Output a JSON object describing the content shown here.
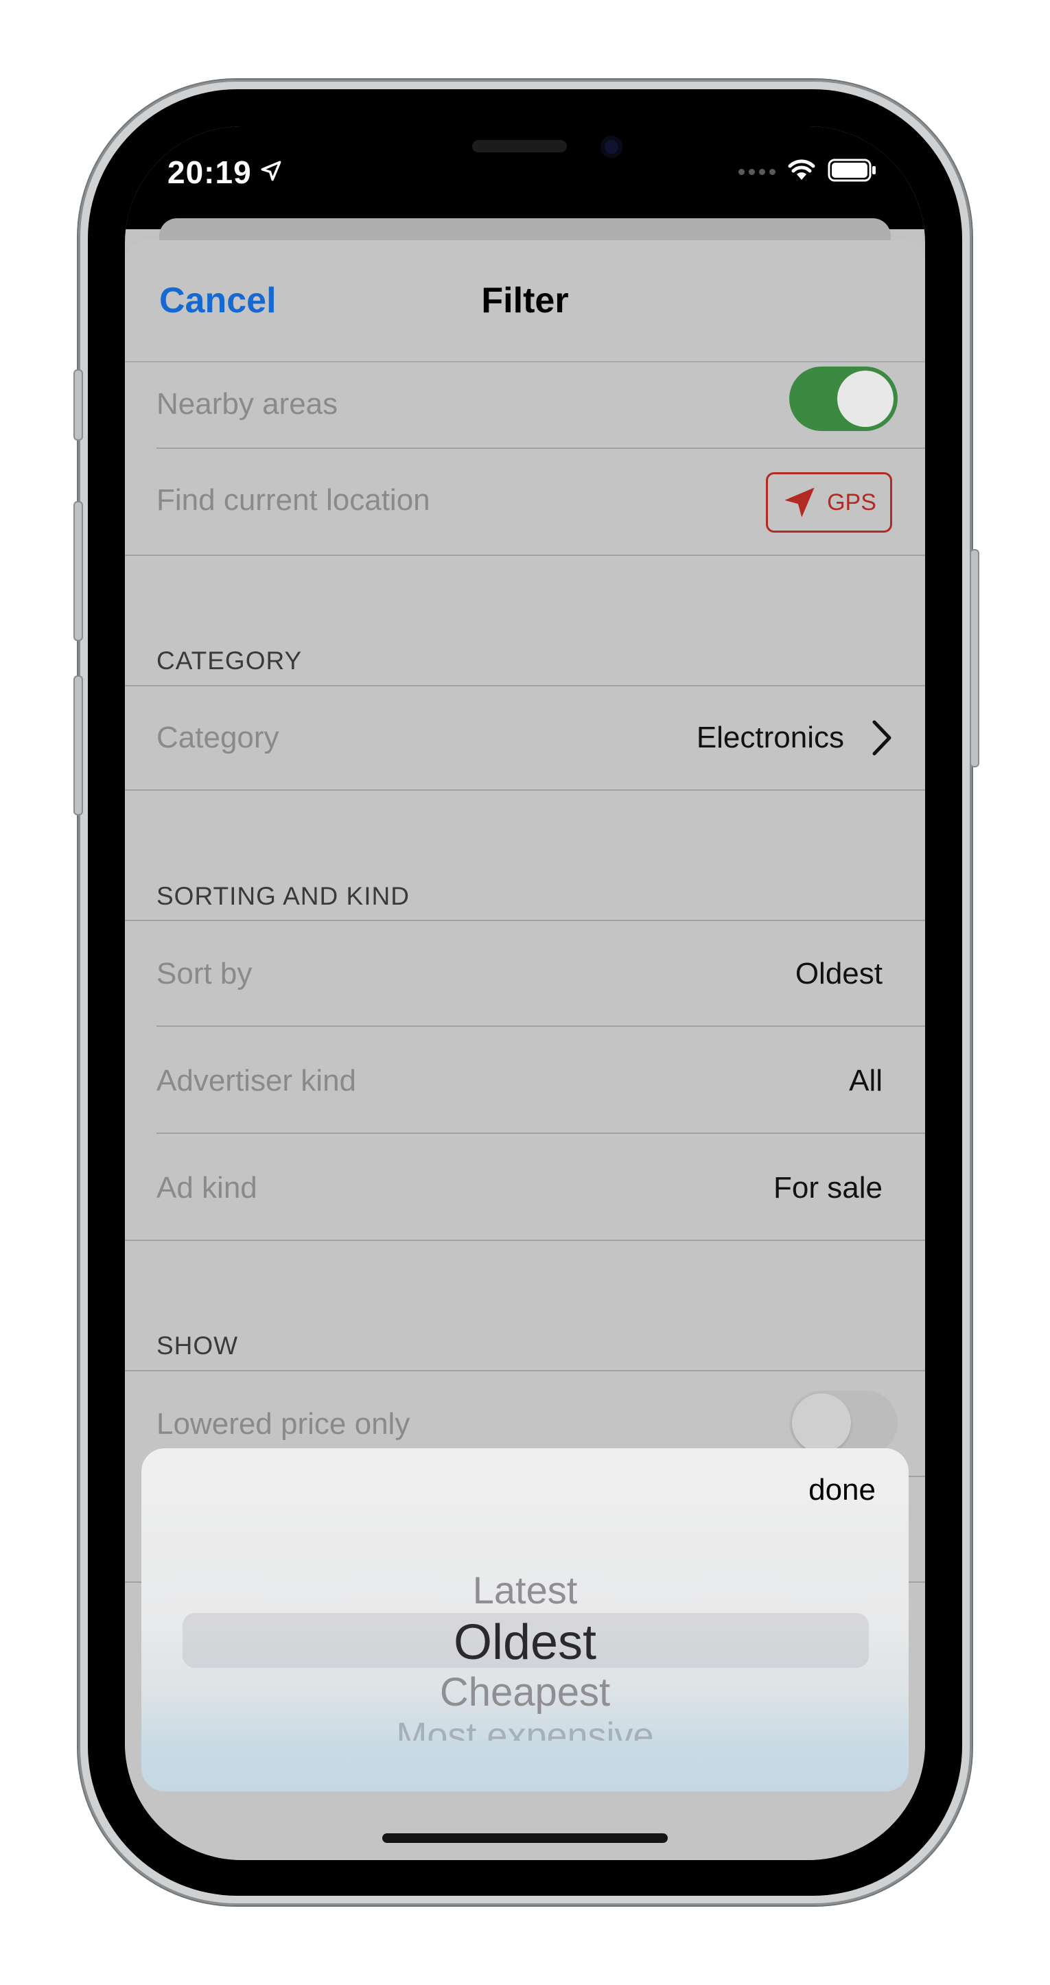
{
  "status_bar": {
    "time": "20:19"
  },
  "nav": {
    "cancel_label": "Cancel",
    "title": "Filter"
  },
  "rows": {
    "nearby_areas": {
      "label": "Nearby areas",
      "toggle_on": true
    },
    "find_location": {
      "label": "Find current location",
      "button_label": "GPS"
    }
  },
  "category_section": {
    "header": "CATEGORY",
    "category": {
      "label": "Category",
      "value": "Electronics"
    }
  },
  "sorting_section": {
    "header": "SORTING AND KIND",
    "sort_by": {
      "label": "Sort by",
      "value": "Oldest"
    },
    "advertiser_kind": {
      "label": "Advertiser kind",
      "value": "All"
    },
    "ad_kind": {
      "label": "Ad kind",
      "value": "For sale"
    }
  },
  "show_section": {
    "header": "SHOW",
    "lowered_price": {
      "label": "Lowered price only",
      "toggle_on": false
    }
  },
  "picker": {
    "done_label": "done",
    "options": [
      "Latest",
      "Oldest",
      "Cheapest",
      "Most expensive"
    ],
    "selected": "Oldest"
  },
  "colors": {
    "accent_blue": "#1769d2",
    "toggle_green": "#3c8a41",
    "gps_red": "#b32a24"
  }
}
